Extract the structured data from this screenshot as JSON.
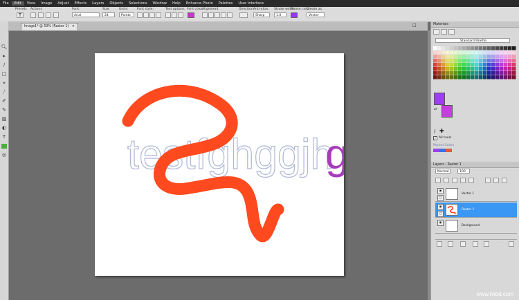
{
  "menu": [
    "File",
    "Edit",
    "View",
    "Image",
    "Adjust",
    "Effects",
    "Layers",
    "Objects",
    "Selections",
    "Window",
    "Help",
    "Enhance Photo",
    "Palettes",
    "User Interface"
  ],
  "tool_options": {
    "presets_label": "Presets",
    "actions_label": "Actions",
    "font_label": "Font:",
    "font_value": "Arial",
    "size_label": "Size:",
    "size_value": "24",
    "units_label": "Units:",
    "units_value": "Points",
    "font_style_label": "Font style:",
    "text_options_label": "Text options:",
    "font_color_label": "Font color:",
    "font_color": "#cc33cc",
    "alignment_label": "Alignment:",
    "direction_label": "Direction:",
    "antialias_label": "Anti-alias:",
    "antialias_value": "Sharp",
    "stroke_width_label": "Stroke width:",
    "stroke_width_value": "1.0",
    "stroke_color_label": "Stroke color:",
    "stroke_color": "#9933ff",
    "create_as_label": "Create as:",
    "create_as_value": "Vector"
  },
  "document_tab": {
    "title": "Image1* @ 50% (Raster 1)"
  },
  "canvas_text": {
    "outlined": "testfghggjh",
    "colored": "g",
    "colored_color": "#a73bbb"
  },
  "materials": {
    "title": "Materials",
    "palette_value": "Standard Palette",
    "all_tools_label": "All tools",
    "recent_label": "Recent Colors",
    "foreground": "#9c3ff0",
    "background": "#c53ee0"
  },
  "layers": {
    "title": "Layers - Raster 1",
    "blend_mode": "Normal",
    "opacity": "100",
    "rows": [
      {
        "name": "Vector 1",
        "selected": false
      },
      {
        "name": "Raster 1",
        "selected": true
      },
      {
        "name": "Background",
        "selected": false
      }
    ]
  },
  "watermark": "www.tvidd.com"
}
